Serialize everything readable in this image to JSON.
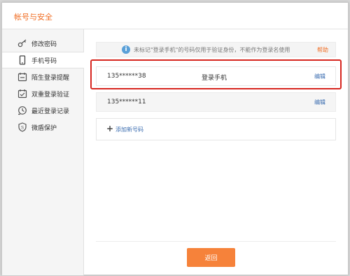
{
  "window": {
    "title": "帐号与安全"
  },
  "sidebar": {
    "items": [
      {
        "label": "修改密码",
        "icon": "key-icon"
      },
      {
        "label": "手机号码",
        "icon": "phone-icon",
        "active": true
      },
      {
        "label": "陌生登录提醒",
        "icon": "alert-icon"
      },
      {
        "label": "双重登录验证",
        "icon": "verify-icon"
      },
      {
        "label": "最近登录记录",
        "icon": "history-icon"
      },
      {
        "label": "微盾保护",
        "icon": "shield-icon"
      }
    ]
  },
  "main": {
    "notice": {
      "text": "未标记\"登录手机\"的号码仅用于验证身份，不能作为登录名使用",
      "help": "帮助"
    },
    "phones": [
      {
        "number": "135******38",
        "tag": "登录手机",
        "edit": "编辑"
      },
      {
        "number": "135******11",
        "tag": "",
        "edit": "编辑"
      }
    ],
    "add": {
      "label": "添加新号码"
    },
    "return_label": "返回"
  },
  "colors": {
    "accent": "#f06d23",
    "button": "#f6823a",
    "link": "#3b6db0",
    "highlight": "#d7261f"
  }
}
